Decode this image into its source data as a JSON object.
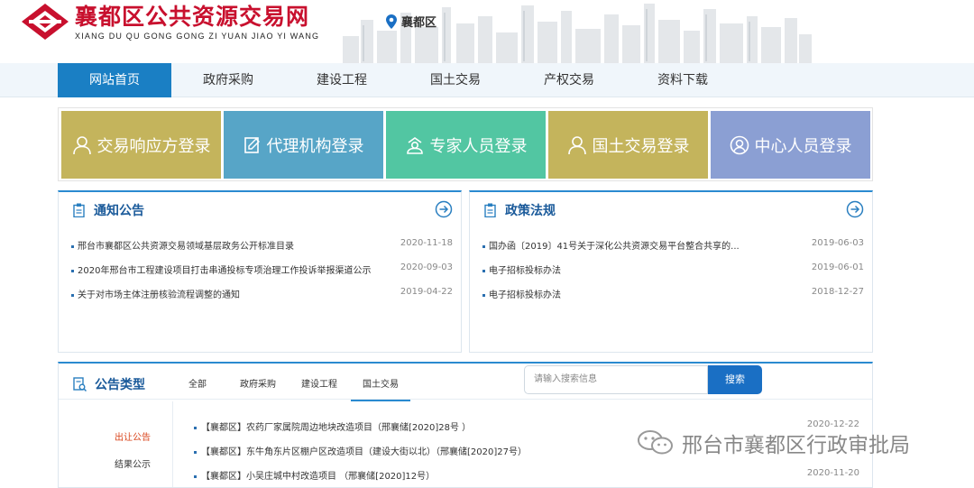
{
  "brand": {
    "title": "襄都区公共资源交易网",
    "subtitle": "XIANG DU QU GONG GONG ZI YUAN JIAO YI WANG",
    "region": "襄都区",
    "colors": {
      "brand_red": "#c8102e",
      "nav_active": "#1a7fc4"
    }
  },
  "nav": {
    "items": [
      {
        "label": "网站首页",
        "active": true
      },
      {
        "label": "政府采购"
      },
      {
        "label": "建设工程"
      },
      {
        "label": "国土交易"
      },
      {
        "label": "产权交易"
      },
      {
        "label": "资料下载"
      }
    ]
  },
  "login_tiles": [
    {
      "label": "交易响应方登录",
      "icon": "user-icon",
      "color": "#c4b45c"
    },
    {
      "label": "代理机构登录",
      "icon": "document-edit-icon",
      "color": "#57a5c7"
    },
    {
      "label": "专家人员登录",
      "icon": "expert-icon",
      "color": "#52c6a2"
    },
    {
      "label": "国土交易登录",
      "icon": "user-icon",
      "color": "#c4b45c"
    },
    {
      "label": "中心人员登录",
      "icon": "user-circle-icon",
      "color": "#8b9fd3"
    }
  ],
  "notice_panel": {
    "title": "通知公告",
    "items": [
      {
        "text": "邢台市襄都区公共资源交易领域基层政务公开标准目录",
        "date": "2020-11-18"
      },
      {
        "text": "2020年邢台市工程建设项目打击串通投标专项治理工作投诉举报渠道公示",
        "date": "2020-09-03"
      },
      {
        "text": "关于对市场主体注册核验流程调整的通知",
        "date": "2019-04-22"
      }
    ]
  },
  "policy_panel": {
    "title": "政策法规",
    "items": [
      {
        "text": "国办函〔2019〕41号关于深化公共资源交易平台整合共享的...",
        "date": "2019-06-03"
      },
      {
        "text": "电子招标投标办法",
        "date": "2019-06-01"
      },
      {
        "text": "电子招标投标办法",
        "date": "2018-12-27"
      }
    ]
  },
  "announcements": {
    "title": "公告类型",
    "tabs": [
      {
        "label": "全部"
      },
      {
        "label": "政府采购"
      },
      {
        "label": "建设工程"
      },
      {
        "label": "国土交易",
        "active": true
      }
    ],
    "search": {
      "placeholder": "请输入搜索信息",
      "button": "搜索"
    },
    "categories": [
      {
        "label": "出让公告",
        "active": true
      },
      {
        "label": "结果公示"
      }
    ],
    "items": [
      {
        "text": "【襄都区】农药厂家属院周边地块改造项目（邢襄储[2020]28号 ）",
        "date": "2020-12-22"
      },
      {
        "text": "【襄都区】东牛角东片区棚户区改造项目（建设大街以北）（邢襄储[2020]27号）",
        "date": ""
      },
      {
        "text": "【襄都区】小吴庄城中村改造项目 （邢襄储[2020]12号）",
        "date": "2020-11-20"
      }
    ]
  },
  "watermark": {
    "text": "邢台市襄都区行政审批局"
  }
}
